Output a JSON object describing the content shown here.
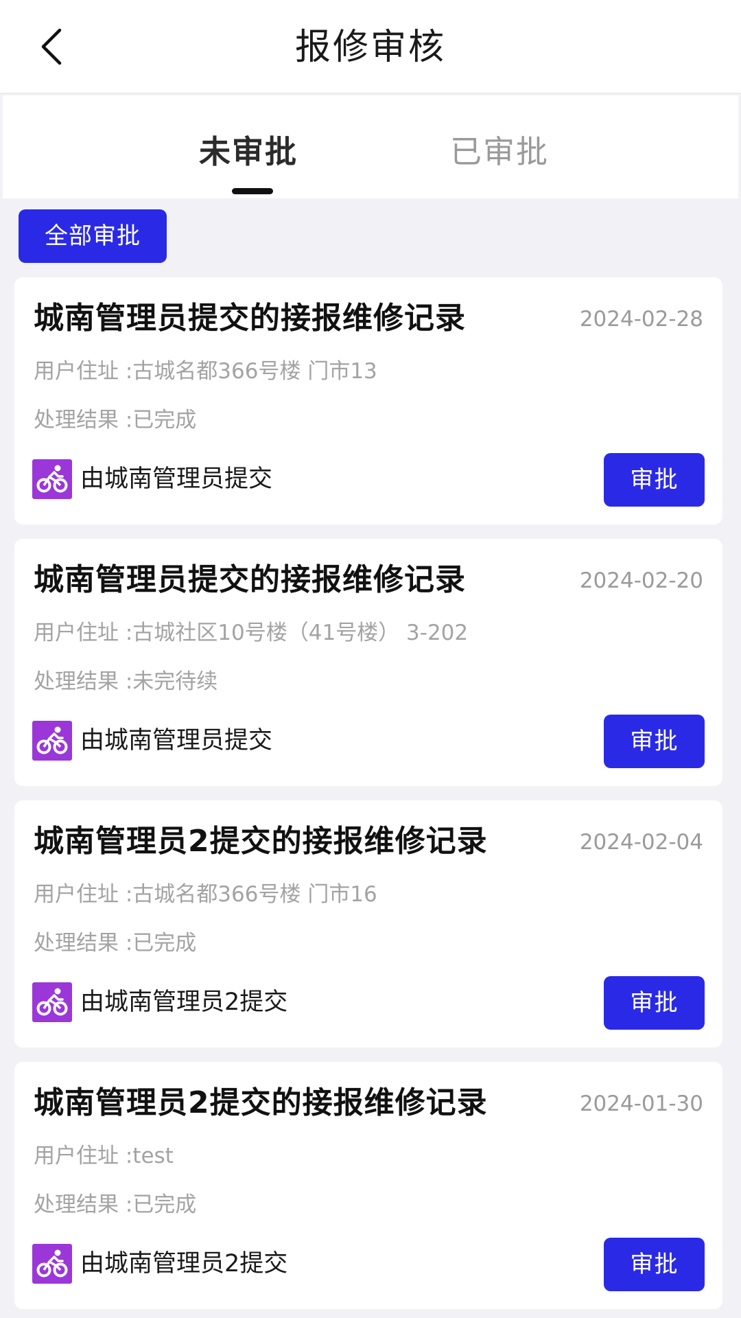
{
  "header": {
    "title": "报修审核",
    "back_icon": "chevron-left-icon"
  },
  "tabs": [
    {
      "label": "未审批",
      "active": true
    },
    {
      "label": "已审批",
      "active": false
    }
  ],
  "bulk_approve_label": "全部审批",
  "colors": {
    "accent": "#2a2ae6",
    "avatar": "#9b36d9",
    "page_bg": "#f2f2f6"
  },
  "records": [
    {
      "title": "城南管理员提交的接报维修记录",
      "date": "2024-02-28",
      "address": "用户住址 :古城名都366号楼 门市13",
      "result": "处理结果 :已完成",
      "submitter": "由城南管理员提交",
      "avatar_icon": "bicycle-icon",
      "approve_label": "审批"
    },
    {
      "title": "城南管理员提交的接报维修记录",
      "date": "2024-02-20",
      "address": "用户住址 :古城社区10号楼（41号楼） 3-202",
      "result": "处理结果 :未完待续",
      "submitter": "由城南管理员提交",
      "avatar_icon": "bicycle-icon",
      "approve_label": "审批"
    },
    {
      "title": "城南管理员2提交的接报维修记录",
      "date": "2024-02-04",
      "address": "用户住址 :古城名都366号楼 门市16",
      "result": "处理结果 :已完成",
      "submitter": "由城南管理员2提交",
      "avatar_icon": "bicycle-icon",
      "approve_label": "审批"
    },
    {
      "title": "城南管理员2提交的接报维修记录",
      "date": "2024-01-30",
      "address": "用户住址 :test",
      "result": "处理结果 :已完成",
      "submitter": "由城南管理员2提交",
      "avatar_icon": "bicycle-icon",
      "approve_label": "审批"
    }
  ]
}
